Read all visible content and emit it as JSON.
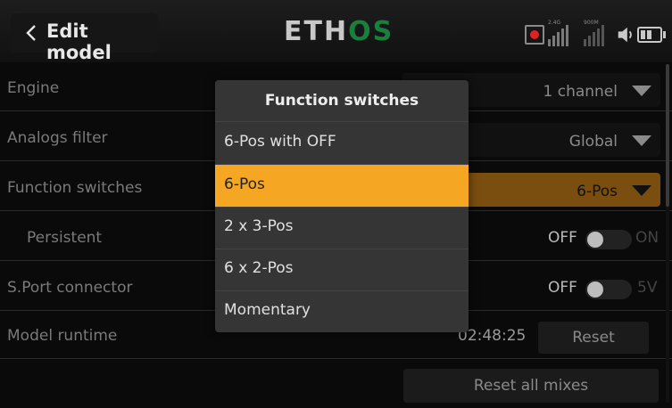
{
  "header": {
    "title": "Edit model",
    "brand_part1": "ETH",
    "brand_part2": "OS",
    "rssi_label_1": "2.4G",
    "rssi_label_2": "900M"
  },
  "rows": {
    "engine": {
      "label": "Engine",
      "value": "1 channel"
    },
    "analogs_filter": {
      "label": "Analogs filter",
      "value": "Global"
    },
    "function_switches": {
      "label": "Function switches",
      "value": "6-Pos"
    },
    "persistent": {
      "label": "Persistent",
      "off": "OFF",
      "on": "ON",
      "state": "off"
    },
    "sport": {
      "label": "S.Port connector",
      "off": "OFF",
      "on": "5V",
      "state": "off"
    },
    "runtime": {
      "label": "Model runtime",
      "time": "02:48:25",
      "reset_label": "Reset"
    },
    "reset_all": {
      "label": "Reset all mixes"
    }
  },
  "popup": {
    "title": "Function switches",
    "options": [
      "6-Pos with OFF",
      "6-Pos",
      "2 x 3-Pos",
      "6 x 2-Pos",
      "Momentary"
    ],
    "selected": "6-Pos"
  },
  "colors": {
    "accent": "#f5a623",
    "selected_row": "#7a4e0f",
    "brand_green": "#1a7f3c"
  }
}
